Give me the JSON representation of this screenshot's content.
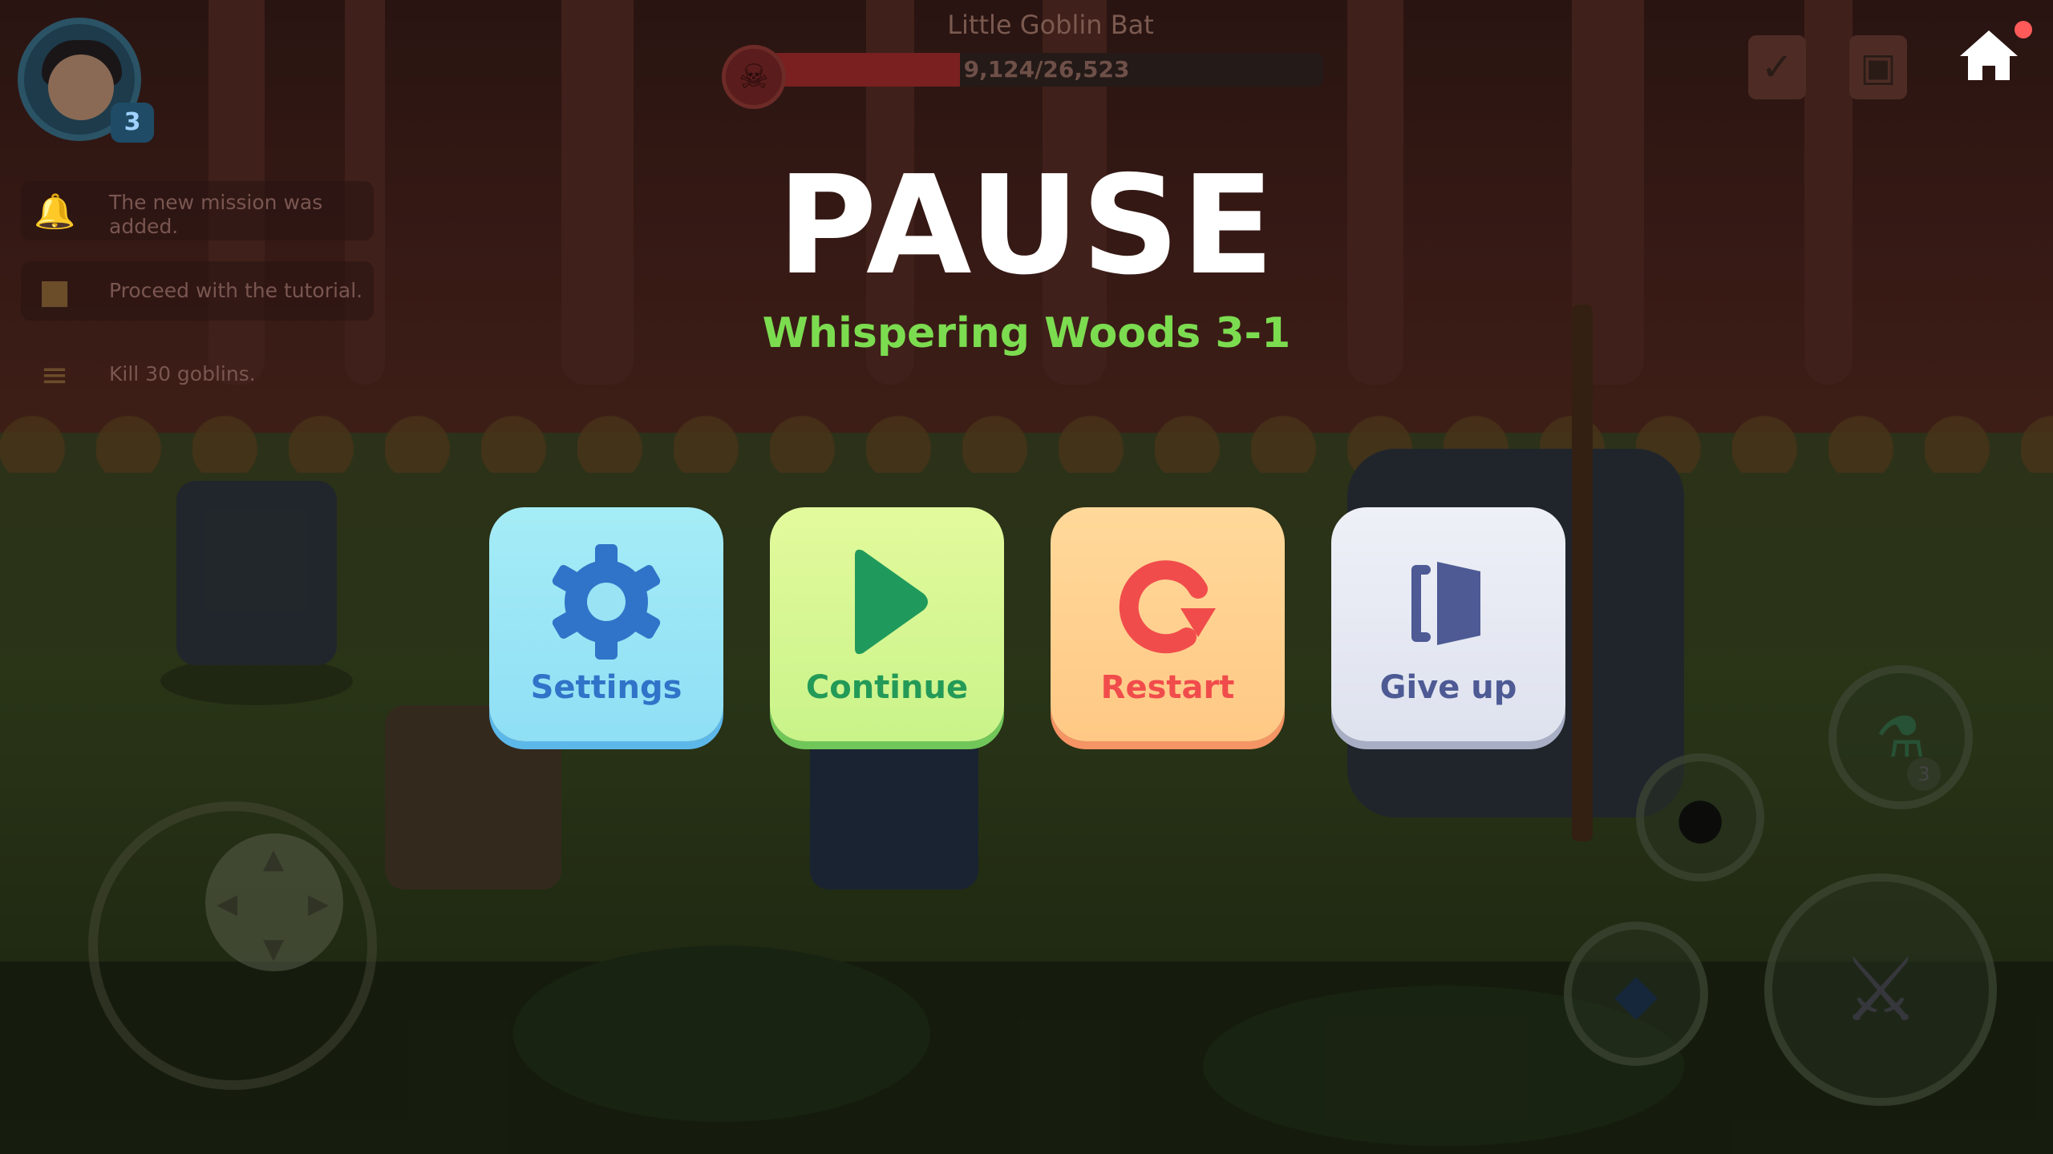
{
  "pause": {
    "title": "PAUSE",
    "stage": "Whispering Woods 3-1",
    "buttons": [
      {
        "label": "Settings",
        "icon": "gear-icon"
      },
      {
        "label": "Continue",
        "icon": "play-icon"
      },
      {
        "label": "Restart",
        "icon": "restart-icon"
      },
      {
        "label": "Give up",
        "icon": "exit-door-icon"
      }
    ]
  },
  "hud": {
    "player_level": "3",
    "boss": {
      "name": "Little Goblin Bat",
      "hp_text": "9,124/26,523",
      "hp_fraction": 0.344
    },
    "missions": [
      {
        "icon": "bell-icon",
        "text": "The new mission was added."
      },
      {
        "icon": "book-icon",
        "text": "Proceed with the tutorial."
      },
      {
        "icon": "scroll-icon",
        "text": "Kill 30 goblins."
      }
    ],
    "potion_count": "3",
    "notification_dot_color": "#ff5a5a"
  },
  "colors": {
    "settings_accent": "#2f74c8",
    "continue_accent": "#239a57",
    "restart_accent": "#f14c4c",
    "giveup_accent": "#4d5a94",
    "stage_text": "#7cdc50"
  }
}
